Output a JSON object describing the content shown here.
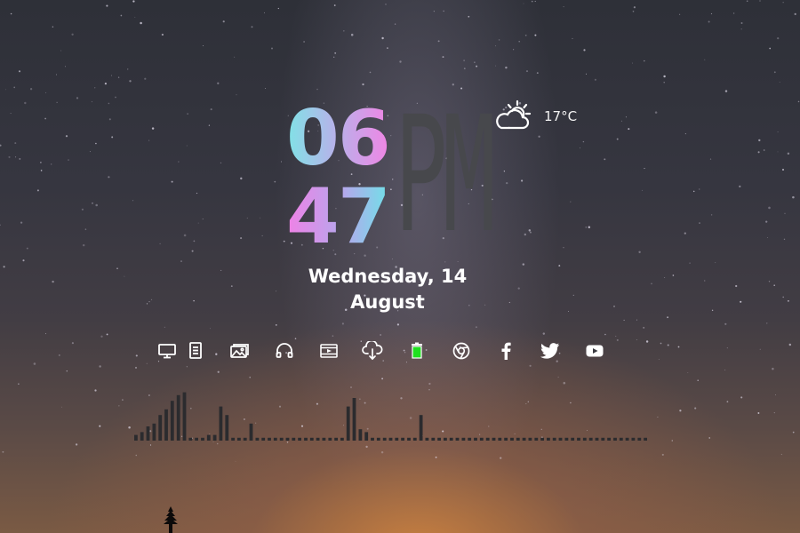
{
  "clock": {
    "hour": "06",
    "minute": "47",
    "ampm": "PM"
  },
  "date": {
    "line1": "Wednesday, 14",
    "line2": "August"
  },
  "weather": {
    "icon": "partly-cloudy-icon",
    "temperature": "17°C"
  },
  "dock": {
    "items": [
      {
        "name": "monitor-icon",
        "color": "#ffffff"
      },
      {
        "name": "document-icon",
        "color": "#ffffff"
      },
      {
        "name": "pictures-icon",
        "color": "#ffffff"
      },
      {
        "name": "headphones-icon",
        "color": "#ffffff"
      },
      {
        "name": "video-icon",
        "color": "#ffffff"
      },
      {
        "name": "cloud-download-icon",
        "color": "#ffffff"
      },
      {
        "name": "recycle-bin-icon",
        "color": "#1fe01f"
      },
      {
        "name": "chrome-icon",
        "color": "#ffffff"
      },
      {
        "name": "facebook-icon",
        "color": "#ffffff"
      },
      {
        "name": "twitter-icon",
        "color": "#ffffff"
      },
      {
        "name": "youtube-icon",
        "color": "#ffffff"
      }
    ]
  },
  "visualizer": {
    "levels": [
      0.1,
      0.15,
      0.25,
      0.3,
      0.45,
      0.55,
      0.7,
      0.8,
      0.85,
      0.05,
      0.05,
      0.05,
      0.1,
      0.1,
      0.6,
      0.45,
      0.05,
      0.05,
      0.05,
      0.3,
      0.05,
      0.05,
      0.05,
      0.05,
      0.05,
      0.05,
      0.05,
      0.05,
      0.05,
      0.05,
      0.05,
      0.05,
      0.05,
      0.05,
      0.05,
      0.6,
      0.75,
      0.2,
      0.15,
      0.05,
      0.05,
      0.05,
      0.05,
      0.05,
      0.05,
      0.05,
      0.05,
      0.45,
      0.05,
      0.05,
      0.05,
      0.05,
      0.05,
      0.05,
      0.05,
      0.05,
      0.05,
      0.05,
      0.05,
      0.05,
      0.05,
      0.05,
      0.05,
      0.05,
      0.05,
      0.05,
      0.05,
      0.05,
      0.05,
      0.05,
      0.05,
      0.05,
      0.05,
      0.05,
      0.05,
      0.05,
      0.05,
      0.05,
      0.05,
      0.05,
      0.05,
      0.05,
      0.05,
      0.05,
      0.05
    ],
    "color": "#2b2b2e"
  }
}
